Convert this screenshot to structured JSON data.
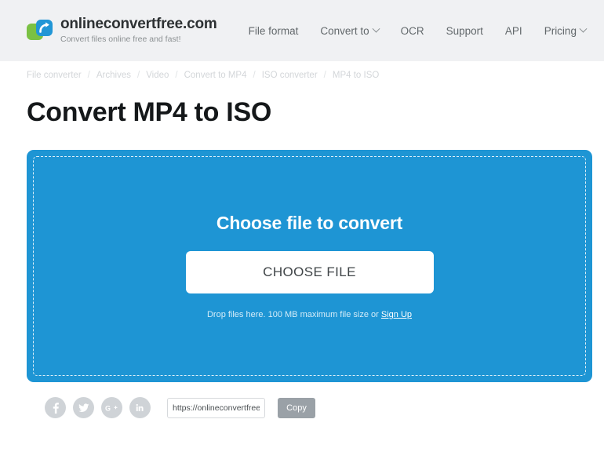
{
  "header": {
    "brand_name": "onlineconvertfree.com",
    "brand_tagline": "Convert files online free and fast!",
    "nav": [
      {
        "label": "File format",
        "has_caret": false
      },
      {
        "label": "Convert to",
        "has_caret": true
      },
      {
        "label": "OCR",
        "has_caret": false
      },
      {
        "label": "Support",
        "has_caret": false
      },
      {
        "label": "API",
        "has_caret": false
      },
      {
        "label": "Pricing",
        "has_caret": true
      }
    ]
  },
  "breadcrumb": {
    "separator": "/",
    "items": [
      "File converter",
      "Archives",
      "Video",
      "Convert to MP4",
      "ISO converter",
      "MP4 to ISO"
    ]
  },
  "page": {
    "title": "Convert MP4 to ISO"
  },
  "dropzone": {
    "title": "Choose file to convert",
    "choose_button": "CHOOSE FILE",
    "hint_text": "Drop files here. 100 MB maximum file size or ",
    "hint_link": "Sign Up",
    "background_color": "#1e95d4"
  },
  "footer": {
    "social": [
      {
        "name": "facebook",
        "glyph": "f"
      },
      {
        "name": "twitter",
        "glyph": "twitter-bird"
      },
      {
        "name": "google-plus",
        "glyph": "G+"
      },
      {
        "name": "linkedin",
        "glyph": "in"
      }
    ],
    "url_value": "https://onlineconvertfree.",
    "copy_button": "Copy"
  },
  "colors": {
    "accent_blue": "#1e95d4",
    "logo_green": "#7ac143",
    "logo_blue": "#2196d6",
    "header_bg": "#f0f1f3",
    "social_gray": "#cfd3d7",
    "copy_gray": "#9aa1a7"
  }
}
